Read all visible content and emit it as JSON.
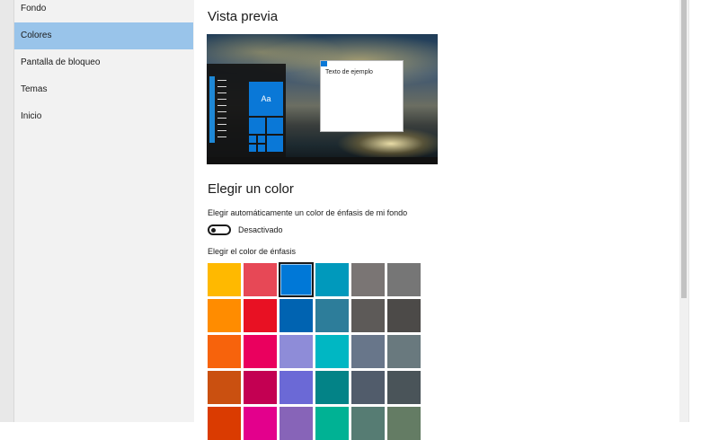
{
  "sidebar": {
    "items": [
      {
        "label": "Fondo",
        "selected": false
      },
      {
        "label": "Colores",
        "selected": true
      },
      {
        "label": "Pantalla de bloqueo",
        "selected": false
      },
      {
        "label": "Temas",
        "selected": false
      },
      {
        "label": "Inicio",
        "selected": false
      }
    ],
    "selected_color": "#99c4ea"
  },
  "main": {
    "preview_heading": "Vista previa",
    "preview": {
      "tile_label": "Aa",
      "sample_text": "Texto de ejemplo",
      "accent_color": "#0a78d7"
    },
    "color_heading": "Elegir un color",
    "auto_label": "Elegir automáticamente un color de énfasis de mi fondo",
    "toggle_state": "Desactivado",
    "toggle_on": false,
    "accent_label": "Elegir el color de énfasis",
    "swatches": [
      [
        "#ffb900",
        "#e74856",
        "#0078d7",
        "#0099bc",
        "#7a7574",
        "#767676"
      ],
      [
        "#ff8c00",
        "#e81123",
        "#0063b1",
        "#2d7d9a",
        "#5d5a58",
        "#4c4a48"
      ],
      [
        "#f7630c",
        "#ea005e",
        "#8e8cd8",
        "#00b7c3",
        "#68768a",
        "#69797e"
      ],
      [
        "#ca5010",
        "#c30052",
        "#6b69d6",
        "#038387",
        "#515c6b",
        "#4a5459"
      ],
      [
        "#da3b01",
        "#e3008c",
        "#8764b8",
        "#00b294",
        "#567c73",
        "#647c64"
      ]
    ],
    "selected_swatch": [
      0,
      2
    ]
  },
  "scrollbar": {
    "thumb_fraction": 0.7
  }
}
